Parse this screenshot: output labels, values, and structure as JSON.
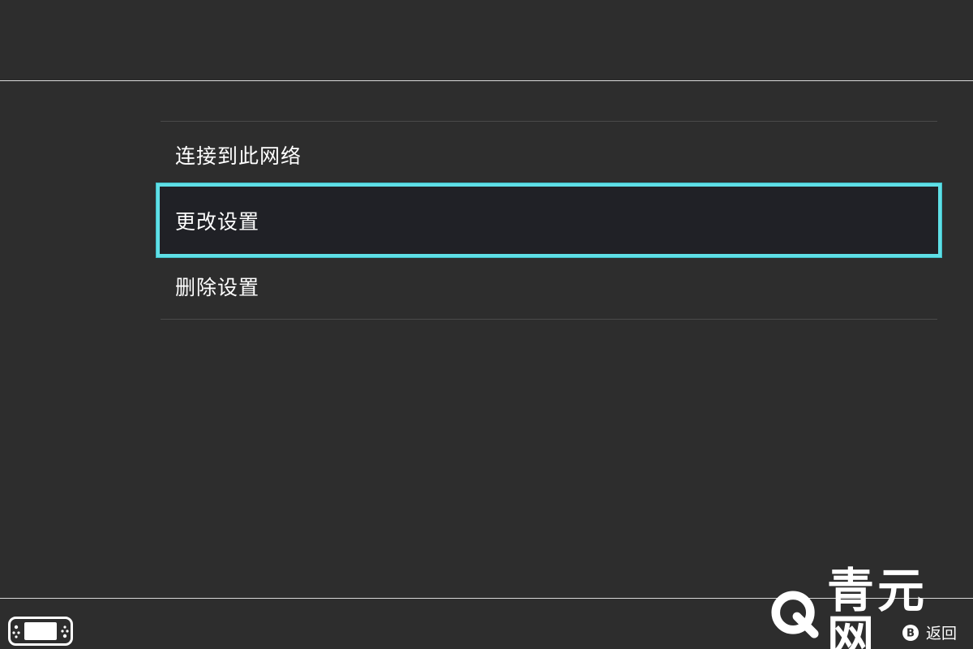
{
  "menu": {
    "items": [
      {
        "label": "连接到此网络",
        "selected": false
      },
      {
        "label": "更改设置",
        "selected": true
      },
      {
        "label": "删除设置",
        "selected": false
      }
    ]
  },
  "footer": {
    "controller_icon": "handheld-console-icon",
    "back_label": "返回",
    "back_button_icon": "b-button-icon"
  },
  "watermark": {
    "text": "青元网",
    "logo_icon": "q-logo-icon"
  },
  "colors": {
    "background": "#2d2d2d",
    "selection_border": "#5fdfe6",
    "selection_fill": "#202126",
    "divider": "#4a4a4a",
    "text": "#ffffff"
  }
}
